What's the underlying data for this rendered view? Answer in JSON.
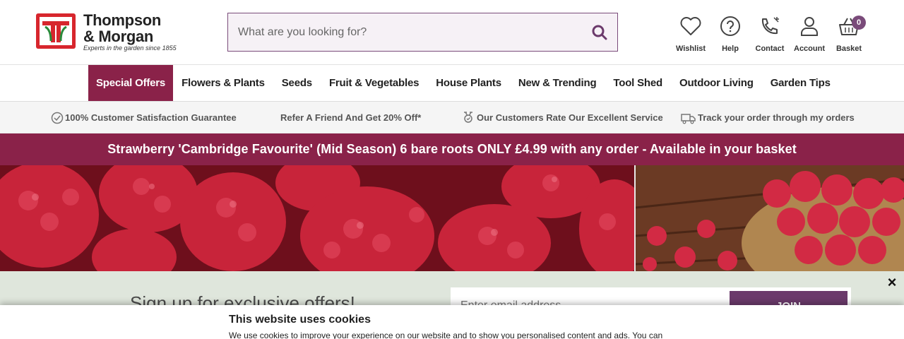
{
  "brand": {
    "name_line1": "Thompson",
    "name_line2": "& Morgan",
    "tagline": "Experts in the garden since 1855",
    "accent": "#8a2249",
    "purple": "#6b3a6b",
    "logo_red": "#d7262d"
  },
  "search": {
    "placeholder": "What are you looking for?",
    "value": "",
    "icon": "search-icon"
  },
  "tools": [
    {
      "label": "Wishlist",
      "icon": "heart-icon"
    },
    {
      "label": "Help",
      "icon": "help-icon"
    },
    {
      "label": "Contact",
      "icon": "phone-icon"
    },
    {
      "label": "Account",
      "icon": "user-icon"
    },
    {
      "label": "Basket",
      "icon": "basket-icon",
      "count": "0"
    }
  ],
  "nav": {
    "items": [
      {
        "label": "Special Offers",
        "active": true
      },
      {
        "label": "Flowers & Plants"
      },
      {
        "label": "Seeds"
      },
      {
        "label": "Fruit & Vegetables"
      },
      {
        "label": "House Plants"
      },
      {
        "label": "New & Trending"
      },
      {
        "label": "Tool Shed"
      },
      {
        "label": "Outdoor Living"
      },
      {
        "label": "Garden Tips"
      }
    ]
  },
  "usp": [
    {
      "label": "100% Customer Satisfaction Guarantee",
      "icon": "check-circle-icon"
    },
    {
      "label": "Refer A Friend And Get 20% Off*",
      "icon": ""
    },
    {
      "label": "Our Customers Rate Our Excellent Service",
      "icon": "award-icon"
    },
    {
      "label": "Track your order through my orders",
      "icon": "truck-icon"
    }
  ],
  "promo": {
    "text": "Strawberry 'Cambridge Favourite' (Mid Season) 6 bare roots ONLY £4.99 with any order - Available in your basket"
  },
  "hero": {
    "image": "raspberries-banner"
  },
  "signup": {
    "title": "Sign up for exclusive offers!",
    "email_placeholder": "Enter email address",
    "join_label": "JOIN",
    "close_label": "×"
  },
  "cookie": {
    "title": "This website uses cookies",
    "text": "We use cookies to improve your experience on our website and to show you personalised content and ads. You can"
  }
}
